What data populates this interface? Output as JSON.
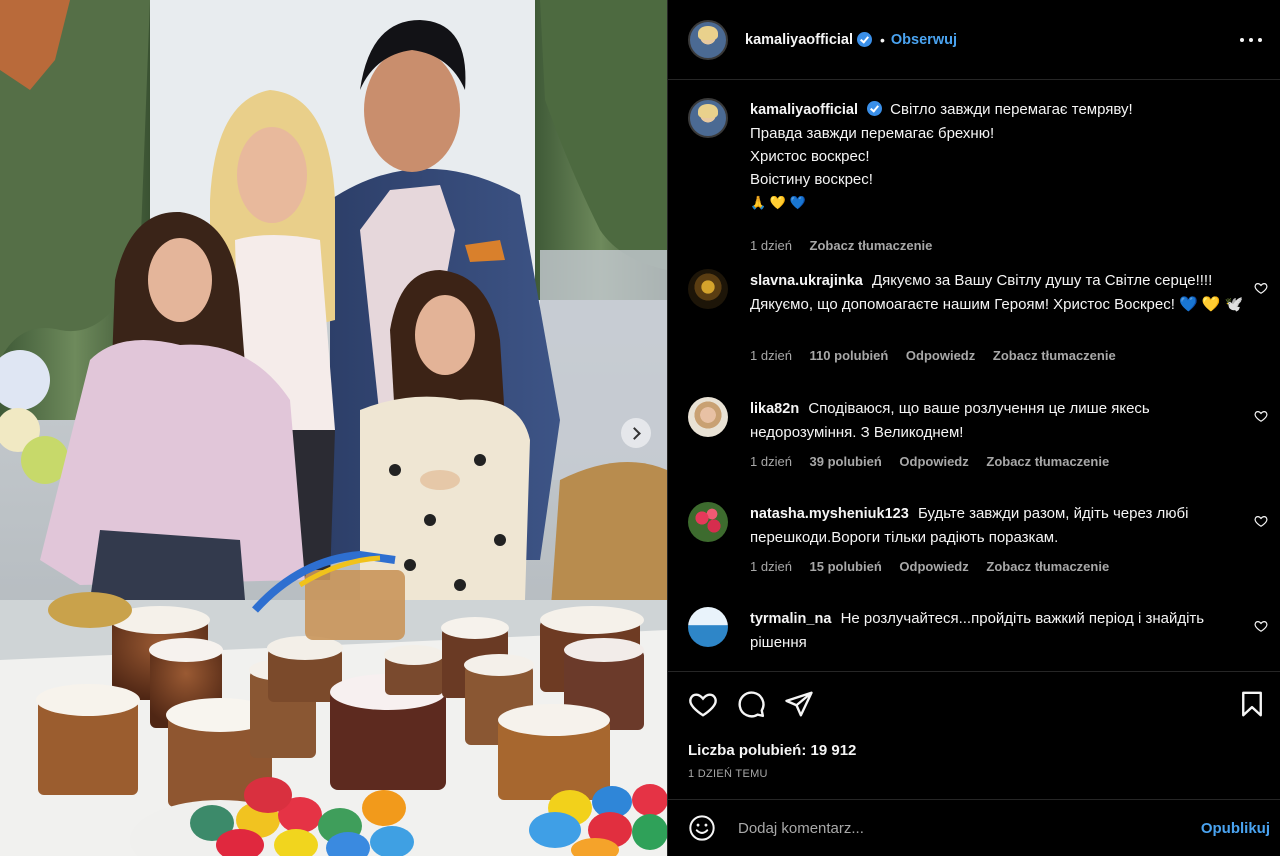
{
  "post": {
    "author": "kamaliyaofficial",
    "follow_label": "Obserwuj",
    "separator": "•",
    "more_icon": "more-horizontal-icon",
    "caption": {
      "lines": [
        "Світло завжди перемагає темряву!",
        "Правда завжди перемагає брехню!",
        "Христос воскрес!",
        "Воістину воскрес!",
        "🙏 💛 💙"
      ],
      "time": "1 dzień",
      "translate": "Zobacz tłumaczenie"
    },
    "comments": [
      {
        "user": "slavna.ukrajinka",
        "text": "Дякуємо за Вашу Світлу душу та Світле серце!!!! Дякуємо, що допомоагаєте нашим Героям! Христос Воскрес! 💙 💛 🕊️",
        "time": "1 dzień",
        "likes": "110 polubień",
        "reply": "Odpowiedz",
        "translate": "Zobacz tłumaczenie"
      },
      {
        "user": "lika82n",
        "text": "Сподіваюся, що ваше розлучення це лише якесь недорозуміння. З Великоднем!",
        "time": "1 dzień",
        "likes": "39 polubień",
        "reply": "Odpowiedz",
        "translate": "Zobacz tłumaczenie"
      },
      {
        "user": "natasha.mysheniuk123",
        "text": "Будьте завжди разом, йдіть через любі перешкоди.Вороги тільки радіють поразкам.",
        "time": "1 dzień",
        "likes": "15 polubień",
        "reply": "Odpowiedz",
        "translate": "Zobacz tłumaczenie"
      },
      {
        "user": "tyrmalin_na",
        "text": "Не розлучайтеся...пройдіть важкий період і знайдіть рішення"
      }
    ],
    "likes_count": "Liczba polubień: 19 912",
    "posted": "1 DZIEŃ TEMU",
    "comment_placeholder": "Dodaj komentarz...",
    "publish_label": "Opublikuj",
    "accent_color": "#4aa3f0",
    "icons": [
      "heart-icon",
      "comment-icon",
      "share-icon",
      "bookmark-icon",
      "emoji-icon",
      "verified-badge-icon",
      "chevron-right-icon"
    ]
  }
}
